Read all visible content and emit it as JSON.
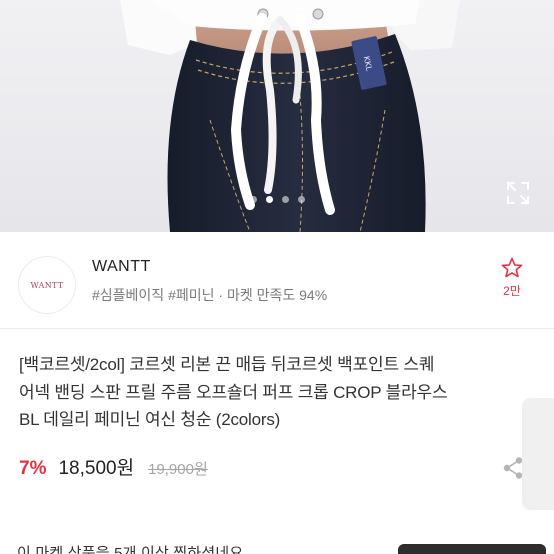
{
  "seller": {
    "logo_text": "WANTT",
    "name": "WANTT",
    "tags": "#심플베이직 #페미닌 · 마켓 만족도 94%",
    "favorite_count": "2만"
  },
  "product": {
    "title_line1": "[백코르셋/2col] 코르셋 리본 끈 매듭 뒤코르셋 백포인트 스퀘",
    "title_line2": "어넥 밴딩 스판 프릴 주름 오프숄더 퍼프 크롭 CROP 블라우스",
    "title_line3": "BL 데일리 페미닌 여신 청순 (2colors)",
    "discount": "7%",
    "price": "18,500원",
    "original_price": "19,900원"
  },
  "gallery": {
    "label_text": "KKL",
    "dots": 4,
    "active_dot": 1
  },
  "banner": {
    "text": "이 마켓 상품을 5개 이상 찜하셨네요"
  },
  "colors": {
    "accent": "#e8313f",
    "denim": "#1f2535",
    "stitch": "#c9a56a"
  }
}
